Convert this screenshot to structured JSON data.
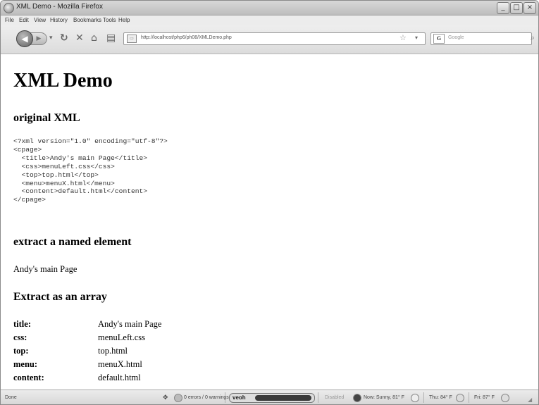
{
  "window": {
    "title": "XML Demo - Mozilla Firefox",
    "minimize": "_",
    "maximize": "□",
    "close": "×"
  },
  "menu": [
    "File",
    "Edit",
    "View",
    "History",
    "Bookmarks",
    "Tools",
    "Help"
  ],
  "toolbar": {
    "url": "http://localhost/php6/ph08/XMLDemo.php",
    "search_placeholder": "Google",
    "search_engine": "G"
  },
  "page": {
    "title": "XML Demo",
    "section_original": "original XML",
    "xml_lines": [
      "<?xml version=\"1.0\" encoding=\"utf-8\"?>",
      "<cpage>",
      "  <title>Andy's main Page</title>",
      "  <css>menuLeft.css</css>",
      "  <top>top.html</top>",
      "  <menu>menuX.html</menu>",
      "  <content>default.html</content>",
      "</cpage>"
    ],
    "section_named": "extract a named element",
    "named_value": "Andy's main Page",
    "section_array": "Extract as an array",
    "array_rows": [
      {
        "key": "title:",
        "value": "Andy's main Page"
      },
      {
        "key": "css:",
        "value": "menuLeft.css"
      },
      {
        "key": "top:",
        "value": "top.html"
      },
      {
        "key": "menu:",
        "value": "menuX.html"
      },
      {
        "key": "content:",
        "value": "default.html"
      }
    ]
  },
  "status": {
    "text": "Done",
    "errors": "0 errors / 0 warnings",
    "disabled": "Disabled",
    "now": "Now: Sunny, 81° F",
    "thu": "Thu: 84° F",
    "fri": "Fri: 87° F"
  }
}
